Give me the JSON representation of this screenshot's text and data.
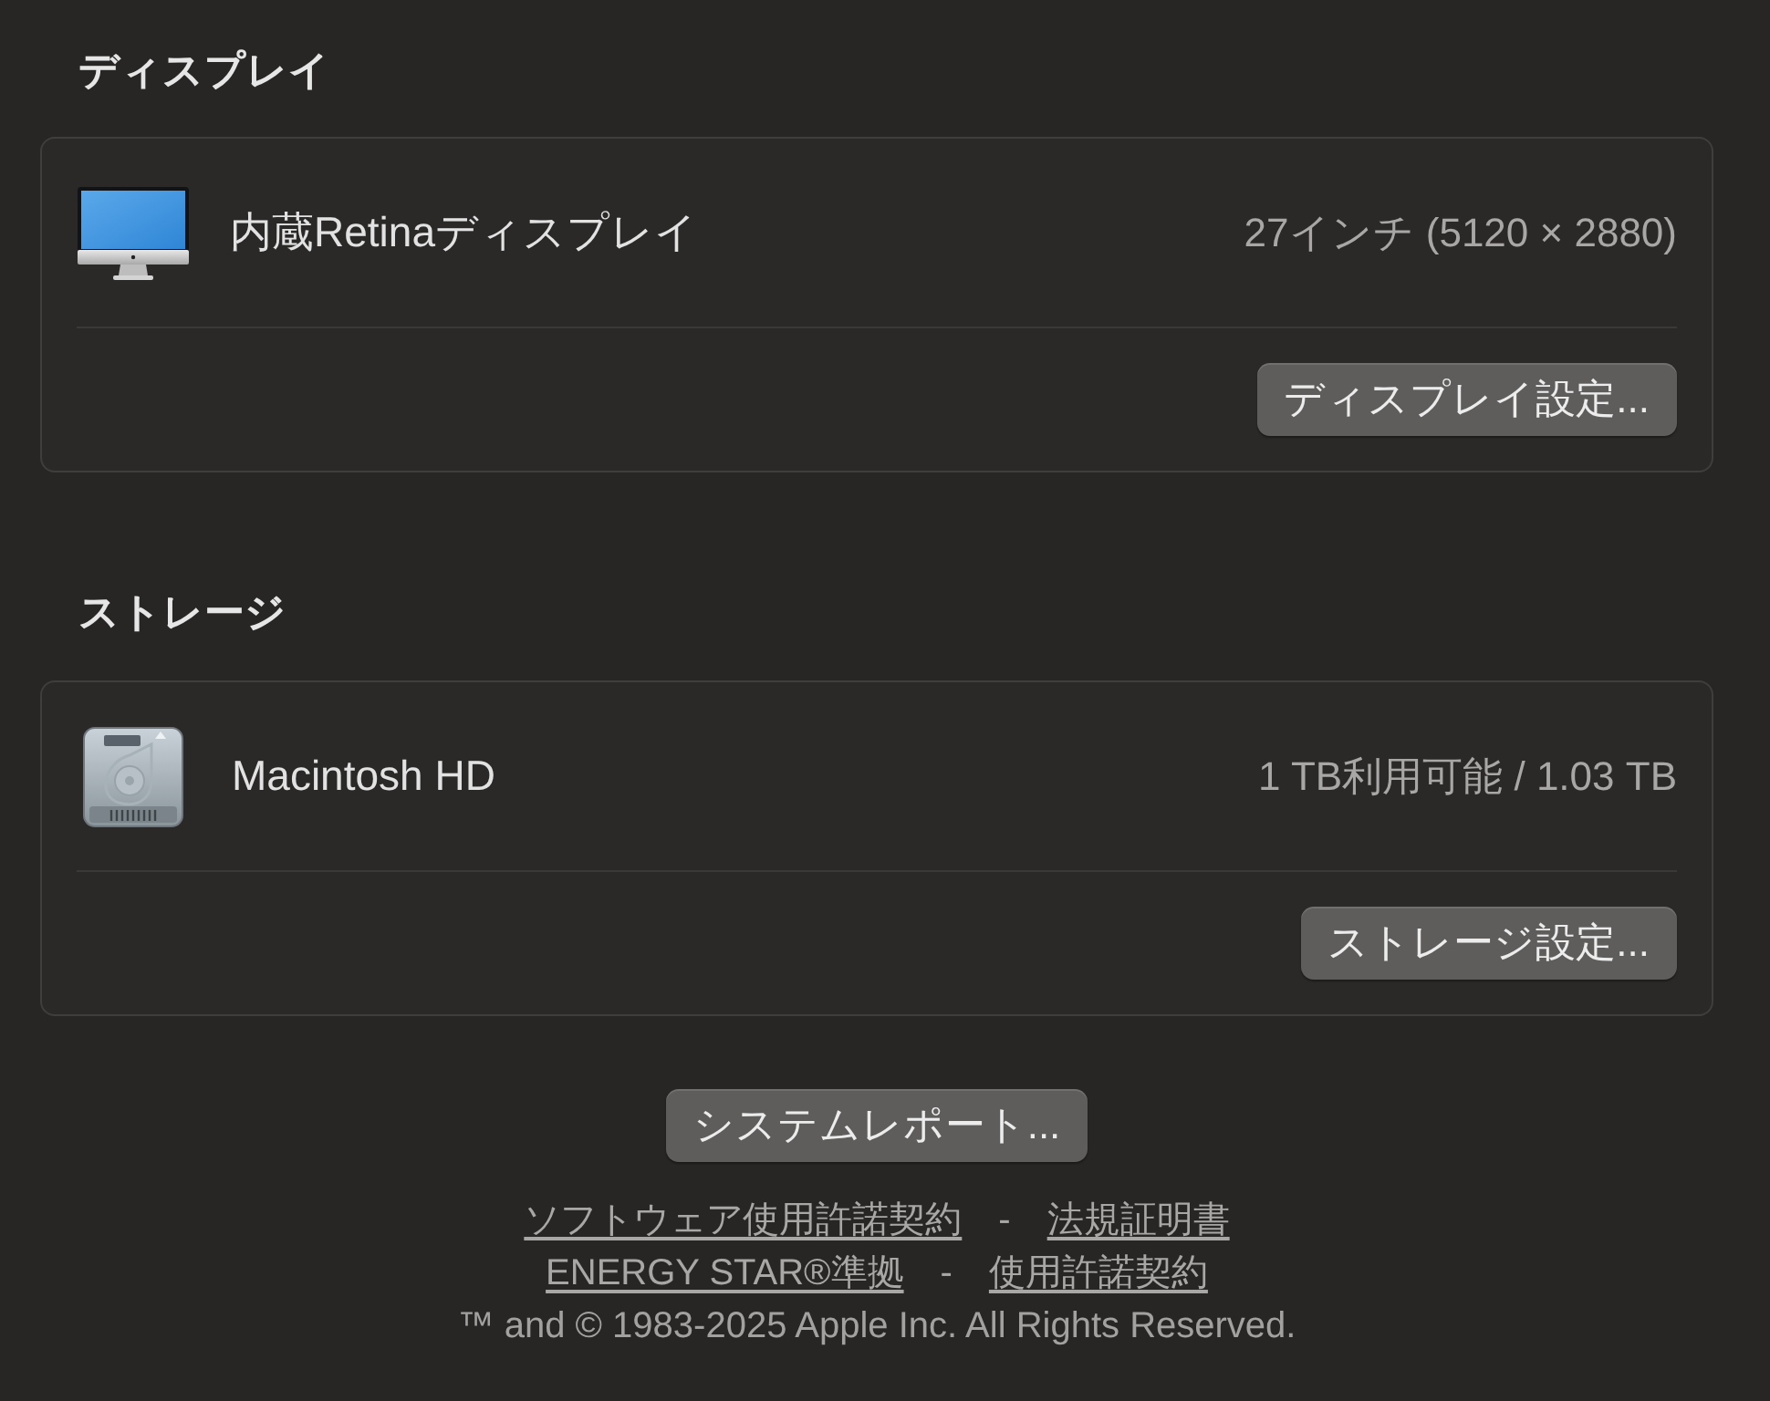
{
  "sections": [
    {
      "title": "ディスプレイ",
      "kind": "display",
      "name": "内蔵Retinaディスプレイ",
      "detail": "27インチ (5120 × 2880)",
      "button": "ディスプレイ設定..."
    },
    {
      "title": "ストレージ",
      "kind": "disk",
      "name": "Macintosh HD",
      "detail": "1 TB利用可能 / 1.03 TB",
      "button": "ストレージ設定..."
    }
  ],
  "system_report_button": "システムレポート...",
  "footer": {
    "link_rows": [
      {
        "left": "ソフトウェア使用許諾契約",
        "separator": "-",
        "right": "法規証明書"
      },
      {
        "left": "ENERGY STAR®準拠",
        "separator": "-",
        "right": "使用許諾契約"
      }
    ],
    "copyright": "™ and © 1983-2025 Apple Inc. All Rights Reserved."
  }
}
